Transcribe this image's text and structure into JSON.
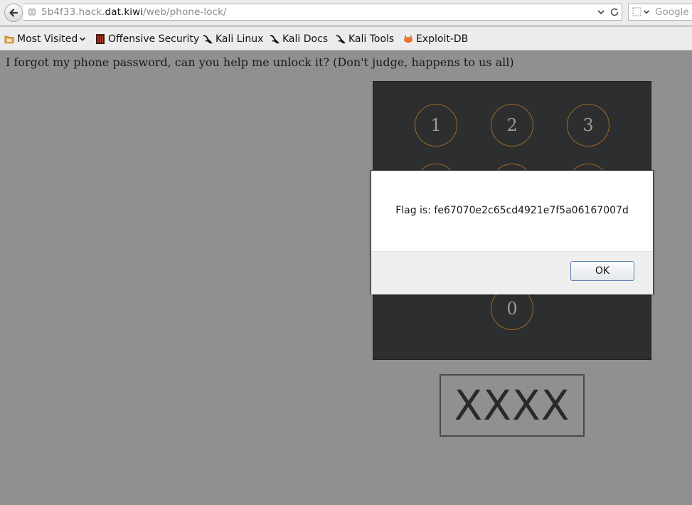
{
  "browser": {
    "url_prefix": "5b4f33.hack.",
    "url_host": "dat.kiwi",
    "url_path": "/web/phone-lock/",
    "search_placeholder": "Google"
  },
  "bookmarks": [
    {
      "label": "Most Visited",
      "icon": "folder-icon"
    },
    {
      "label": "Offensive Security",
      "icon": "offsec-icon"
    },
    {
      "label": "Kali Linux",
      "icon": "kali-dragon-icon"
    },
    {
      "label": "Kali Docs",
      "icon": "kali-dragon-icon"
    },
    {
      "label": "Kali Tools",
      "icon": "kali-dragon-icon"
    },
    {
      "label": "Exploit-DB",
      "icon": "exploitdb-icon"
    }
  ],
  "page": {
    "intro": "I forgot my phone password, can you help me unlock it? (Don't judge, happens to us all)",
    "keys": [
      "1",
      "2",
      "3",
      "0"
    ],
    "display": "XXXX"
  },
  "dialog": {
    "message": "Flag is: fe67070e2c65cd4921e7f5a06167007d",
    "ok_label": "OK"
  },
  "colors": {
    "page_background": "#8e9092",
    "keypad_background": "#2d2e30",
    "key_ring": "#9a6a24"
  }
}
